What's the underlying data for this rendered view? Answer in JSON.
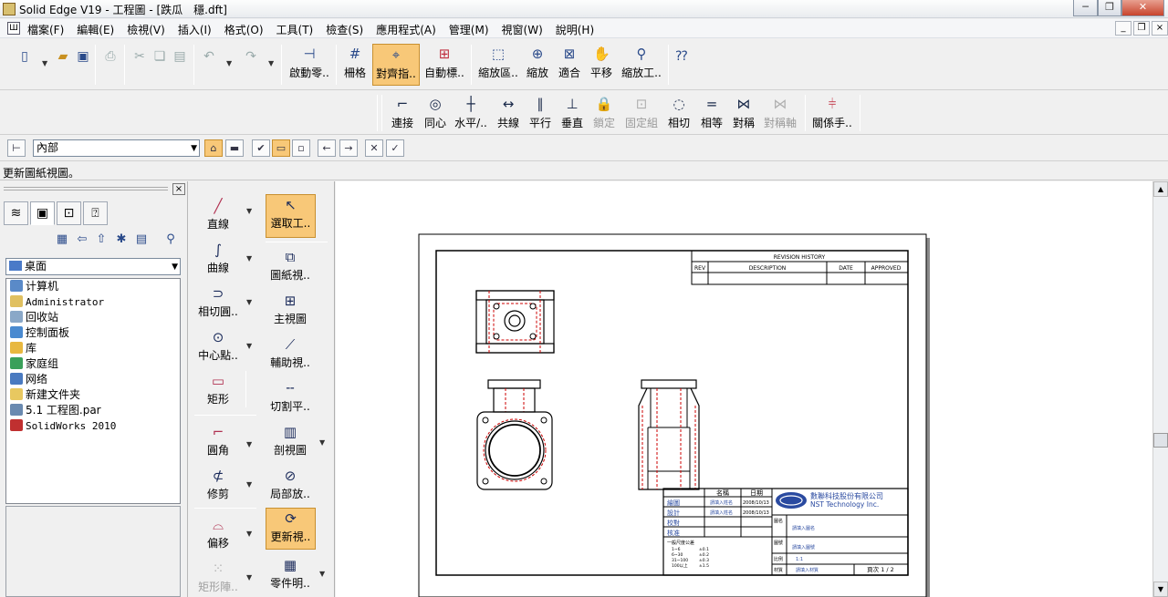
{
  "window": {
    "title": "Solid Edge V19 - 工程圖 - [跌瓜　穩.dft]",
    "buttons": {
      "minimize": "─",
      "restore": "❐",
      "close": "✕"
    }
  },
  "menu": [
    "檔案(F)",
    "編輯(E)",
    "檢視(V)",
    "插入(I)",
    "格式(O)",
    "工具(T)",
    "檢查(S)",
    "應用程式(A)",
    "管理(M)",
    "視窗(W)",
    "說明(H)"
  ],
  "toolbar1": {
    "startup": "啟動零..",
    "grid": "柵格",
    "align": "對齊指..",
    "auto_dim": "自動標..",
    "zoom_area": "縮放區..",
    "zoom": "縮放",
    "fit": "適合",
    "pan": "平移",
    "zoom_tool": "縮放工.."
  },
  "toolbar2": {
    "connect": "連接",
    "concentric": "同心",
    "horizontal": "水平/..",
    "collinear": "共線",
    "parallel": "平行",
    "perpendicular": "垂直",
    "lock": "鎖定",
    "rigid_set": "固定組",
    "tangent": "相切",
    "equal": "相等",
    "symmetric": "對稱",
    "symmetry_axis": "對稱軸",
    "relationship": "關係手.."
  },
  "toolbar3": {
    "layer_value": "內部"
  },
  "status_text": "更新圖紙視圖。",
  "explorer": {
    "location": "桌面",
    "items": [
      {
        "label": "计算机",
        "icon": "computer-icon",
        "color": "#5a8ac8"
      },
      {
        "label": "Administrator",
        "icon": "user-folder-icon",
        "color": "#e0c060",
        "mono": true
      },
      {
        "label": "回收站",
        "icon": "recycle-bin-icon",
        "color": "#8aa8c8"
      },
      {
        "label": "控制面板",
        "icon": "control-panel-icon",
        "color": "#4a8ad0"
      },
      {
        "label": "库",
        "icon": "library-icon",
        "color": "#e8b840"
      },
      {
        "label": "家庭组",
        "icon": "homegroup-icon",
        "color": "#3aa05a"
      },
      {
        "label": "网络",
        "icon": "network-icon",
        "color": "#4a7ac0"
      },
      {
        "label": "新建文件夹",
        "icon": "folder-icon",
        "color": "#e8c860"
      },
      {
        "label": "5.1 工程图.par",
        "icon": "part-file-icon",
        "color": "#6a8ab0"
      },
      {
        "label": "SolidWorks 2010",
        "icon": "solidworks-icon",
        "color": "#c03030",
        "mono": true
      }
    ]
  },
  "drawtools": {
    "line": "直線",
    "curve": "曲線",
    "tangent_arc": "相切圓..",
    "center_point": "中心點..",
    "rectangle": "矩形",
    "fillet": "圓角",
    "trim": "修剪",
    "offset": "偏移",
    "rect_array": "矩形陣..",
    "select": "選取工..",
    "drawing_view": "圖紙視..",
    "principal_view": "主視圖",
    "auxiliary_view": "輔助視..",
    "cutting_plane": "切割平..",
    "section_view": "剖視圖",
    "detail_view": "局部放..",
    "update_view": "更新視..",
    "parts_list": "零件明.."
  },
  "sheet": {
    "revision_history": "REVISION HISTORY",
    "rev_headers": [
      "REV",
      "DESCRIPTION",
      "DATE",
      "APPROVED"
    ],
    "company_cn": "數聯科技股份有限公司",
    "company_en": "NST Technology Inc.",
    "name_header": "名稱",
    "date_header": "日期",
    "rows": [
      "繪圖",
      "設計",
      "校對",
      "核准"
    ],
    "drafter": "請填入姓名",
    "date_value": "2008/10/13",
    "tolerance_title": "一般尺度公差",
    "tolerances": [
      [
        "1~6",
        "±0.1"
      ],
      [
        "6~30",
        "±0.2"
      ],
      [
        "31~100",
        "±0.3"
      ],
      [
        "100以上",
        "±1.5"
      ]
    ],
    "field_drawing_name": "圖名",
    "drawing_name_value": "請填入圖名",
    "field_drawing_no": "圖號",
    "drawing_no_value": "請填入圖號",
    "field_scale": "比例",
    "scale_value": "1:1",
    "field_material": "材質",
    "material_value": "請填入材質",
    "page_label": "頁次 1 / 2"
  },
  "colors": {
    "accent_active": "#f8c878",
    "outline_red": "#cc0000",
    "company_blue": "#2a4aa0"
  }
}
